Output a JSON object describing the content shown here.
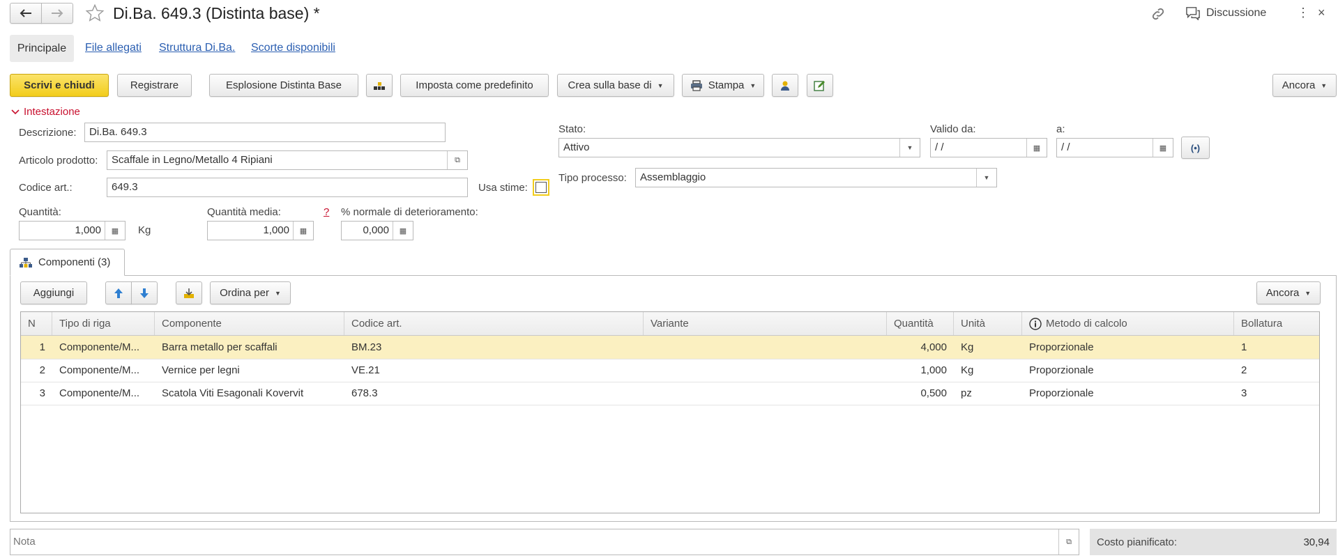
{
  "window": {
    "title": "Di.Ba. 649.3 (Distinta base) *",
    "discussion_label": "Discussione"
  },
  "tabs": [
    {
      "label": "Principale",
      "active": true
    },
    {
      "label": "File allegati"
    },
    {
      "label": "Struttura Di.Ba."
    },
    {
      "label": "Scorte disponibili"
    }
  ],
  "toolbar": {
    "save_close": "Scrivi e chiudi",
    "register": "Registrare",
    "explode": "Esplosione Distinta Base",
    "set_default": "Imposta come predefinito",
    "create_based": "Crea sulla base di",
    "print": "Stampa",
    "more": "Ancora"
  },
  "header": {
    "section_label": "Intestazione",
    "description_label": "Descrizione:",
    "description_value": "Di.Ba. 649.3",
    "product_label": "Articolo prodotto:",
    "product_value": "Scaffale in Legno/Metallo 4 Ripiani",
    "code_label": "Codice art.:",
    "code_value": "649.3",
    "use_estimates_label": "Usa stime:",
    "status_label": "Stato:",
    "status_value": "Attivo",
    "valid_from_label": "Valido da:",
    "valid_from_value": " /  /",
    "valid_to_label": "a:",
    "valid_to_value": " /  /",
    "process_label": "Tipo processo:",
    "process_value": "Assemblaggio",
    "quantity_label": "Quantità:",
    "quantity_value": "1,000",
    "quantity_unit": "Kg",
    "avg_quantity_label": "Quantità media:",
    "avg_quantity_value": "1,000",
    "help_mark": "?",
    "wear_label": "% normale di deterioramento:",
    "wear_value": "0,000"
  },
  "components": {
    "tab_label": "Componenti (3)",
    "add_label": "Aggiungi",
    "sort_label": "Ordina per",
    "more_label": "Ancora",
    "columns": [
      "N",
      "Tipo di riga",
      "Componente",
      "Codice art.",
      "Variante",
      "Quantità",
      "Unità",
      "Metodo di calcolo",
      "Bollatura"
    ],
    "rows": [
      {
        "n": "1",
        "type": "Componente/M...",
        "component": "Barra metallo per scaffali",
        "code": "BM.23",
        "variant": "",
        "qty": "4,000",
        "unit": "Kg",
        "method": "Proporzionale",
        "mark": "1"
      },
      {
        "n": "2",
        "type": "Componente/M...",
        "component": "Vernice per legni",
        "code": "VE.21",
        "variant": "",
        "qty": "1,000",
        "unit": "Kg",
        "method": "Proporzionale",
        "mark": "2"
      },
      {
        "n": "3",
        "type": "Componente/M...",
        "component": "Scatola Viti Esagonali Kovervit",
        "code": "678.3",
        "variant": "",
        "qty": "0,500",
        "unit": "pz",
        "method": "Proporzionale",
        "mark": "3"
      }
    ]
  },
  "footer": {
    "note_placeholder": "Nota",
    "planned_cost_label": "Costo pianificato:",
    "planned_cost_value": "30,94"
  },
  "colors": {
    "primary_button": "#f2cd1c",
    "link": "#2a5eb1",
    "section_accent": "#c8102e",
    "selected_row": "#fbf0c1"
  }
}
